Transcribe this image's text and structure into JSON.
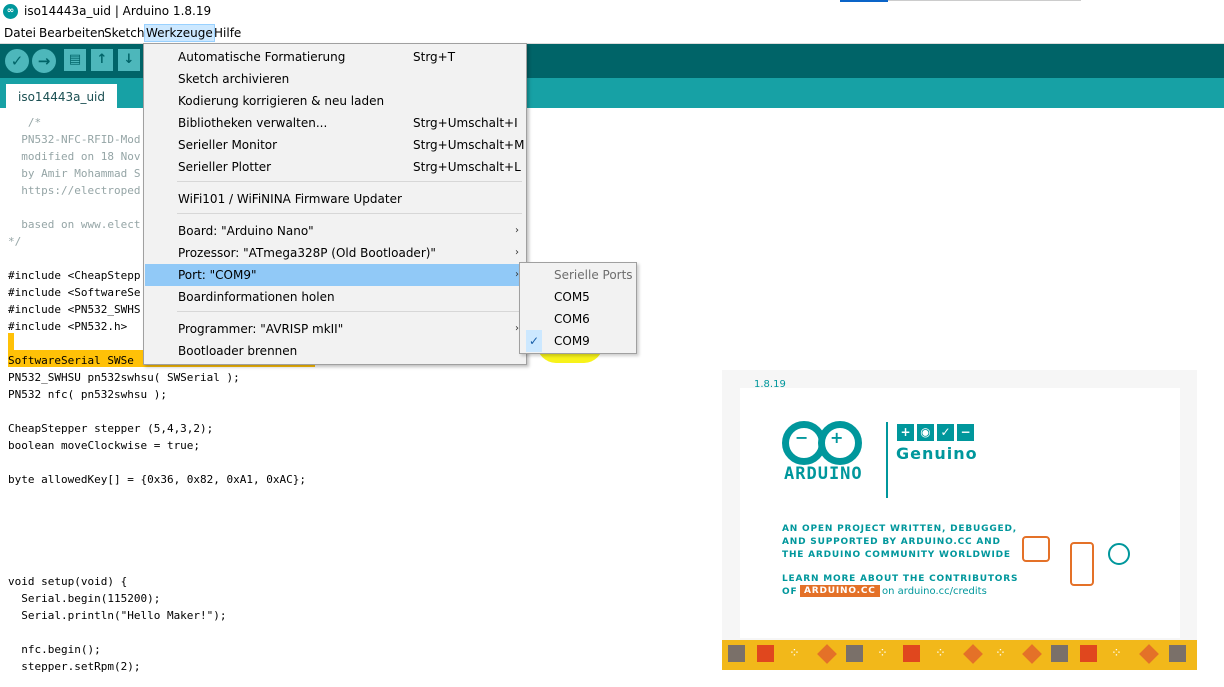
{
  "window": {
    "title": "iso14443a_uid | Arduino 1.8.19",
    "icon": "arduino-app-icon"
  },
  "menubar": {
    "items": [
      "Datei",
      "Bearbeiten",
      "Sketch",
      "Werkzeuge",
      "Hilfe"
    ],
    "active": "Werkzeuge"
  },
  "toolbar": {
    "buttons": [
      "verify-icon",
      "upload-icon",
      "new-icon",
      "open-icon",
      "save-icon"
    ]
  },
  "tab": {
    "label": "iso14443a_uid"
  },
  "code": {
    "lines": [
      "   /*",
      "  PN532-NFC-RFID-Mod",
      "  modified on 18 Nov",
      "  by Amir Mohammad S",
      "  https://electroped",
      "",
      "  based on www.elect",
      "*/",
      "",
      "#include <CheapStepp",
      "#include <SoftwareSe",
      "#include <PN532_SWHS",
      "#include <PN532.h>",
      "",
      "SoftwareSerial SWSe",
      "PN532_SWHSU pn532swhsu( SWSerial );",
      "PN532 nfc( pn532swhsu );",
      "",
      "CheapStepper stepper (5,4,3,2);",
      "boolean moveClockwise = true;",
      "",
      "byte allowedKey[] = {0x36, 0x82, 0xA1, 0xAC};",
      "",
      "",
      "",
      "",
      "",
      "void setup(void) {",
      "  Serial.begin(115200);",
      "  Serial.println(\"Hello Maker!\");",
      "",
      "  nfc.begin();",
      "  stepper.setRpm(2);"
    ]
  },
  "dropdown": {
    "items": [
      {
        "label": "Automatische Formatierung",
        "shortcut": "Strg+T"
      },
      {
        "label": "Sketch archivieren",
        "shortcut": ""
      },
      {
        "label": "Kodierung korrigieren & neu laden",
        "shortcut": ""
      },
      {
        "label": "Bibliotheken verwalten...",
        "shortcut": "Strg+Umschalt+I"
      },
      {
        "label": "Serieller Monitor",
        "shortcut": "Strg+Umschalt+M"
      },
      {
        "label": "Serieller Plotter",
        "shortcut": "Strg+Umschalt+L"
      },
      {
        "label": "WiFi101 / WiFiNINA Firmware Updater",
        "shortcut": ""
      },
      {
        "label": "Board: \"Arduino Nano\"",
        "shortcut": ""
      },
      {
        "label": "Prozessor: \"ATmega328P (Old Bootloader)\"",
        "shortcut": ""
      },
      {
        "label": "Port: \"COM9\"",
        "shortcut": ""
      },
      {
        "label": "Boardinformationen holen",
        "shortcut": ""
      },
      {
        "label": "Programmer: \"AVRISP mkII\"",
        "shortcut": ""
      },
      {
        "label": "Bootloader brennen",
        "shortcut": ""
      }
    ],
    "selected": "Port: \"COM9\""
  },
  "submenu": {
    "header": "Serielle Ports",
    "ports": [
      "COM5",
      "COM6",
      "COM9"
    ],
    "checked": "COM9",
    "highlight_color": "#f7f21a"
  },
  "splash": {
    "version": "1.8.19",
    "brand": "ARDUINO",
    "brand2": "Genuino",
    "line1": "AN OPEN PROJECT WRITTEN, DEBUGGED,",
    "line2": "AND SUPPORTED BY ARDUINO.CC AND",
    "line3": "THE ARDUINO COMMUNITY WORLDWIDE",
    "line4": "LEARN MORE ABOUT THE CONTRIBUTORS",
    "of": "OF",
    "badge": "ARDUINO.CC",
    "credits": "on arduino.cc/credits",
    "accent": "#00979c",
    "orange": "#e47128"
  },
  "colors": {
    "toolbar": "#006468",
    "tabbar": "#17a1a5",
    "selected_menu": "#91c9f7",
    "error_highlight": "#ffc107"
  }
}
